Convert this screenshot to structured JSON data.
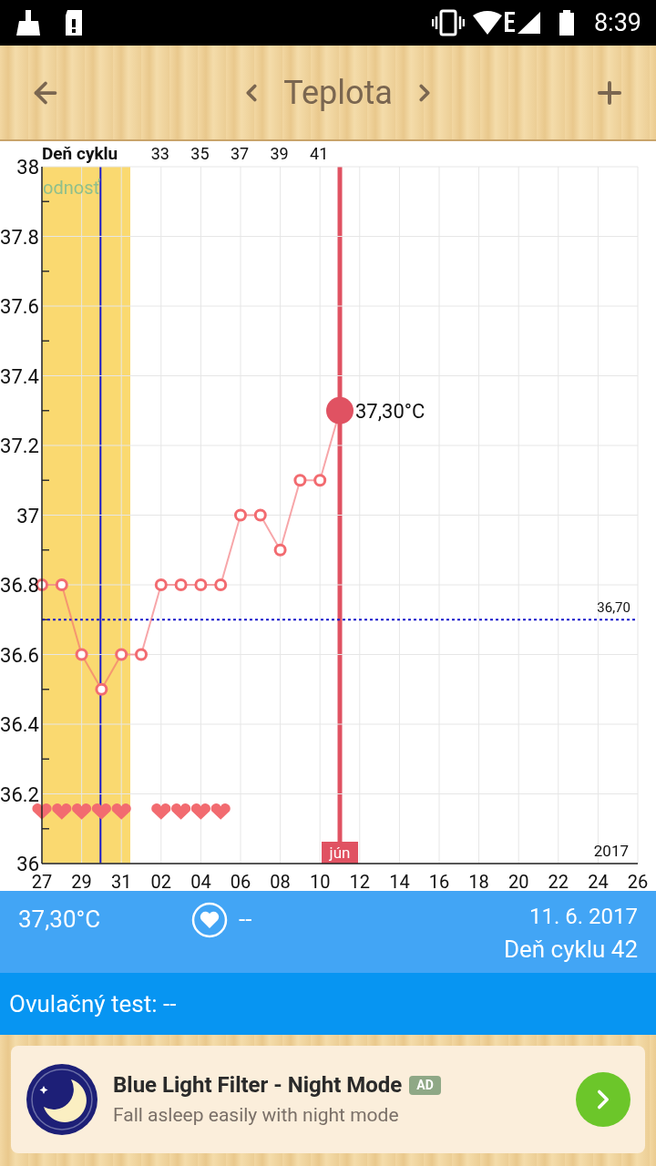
{
  "status_bar": {
    "time": "8:39"
  },
  "header": {
    "title": "Teplota"
  },
  "chart": {
    "chart_data": {
      "type": "line",
      "categories": [
        "27",
        null,
        "29",
        null,
        "31",
        null,
        "02",
        null,
        "04",
        null,
        "06",
        null,
        "08",
        null,
        "10",
        null,
        "12",
        null,
        "14",
        null,
        "16",
        null,
        "18",
        null,
        "20",
        null,
        "22",
        null,
        "24",
        null,
        "26"
      ],
      "grid": true,
      "series": [
        {
          "color": "#f26b70",
          "marker": "circle",
          "values": [
            36.8,
            36.8,
            36.6,
            36.5,
            36.6,
            36.6,
            36.8,
            36.8,
            36.8,
            36.8,
            37.0,
            37.0,
            36.9,
            37.1,
            37.1,
            37.3,
            null,
            null,
            null,
            null,
            null,
            null,
            null,
            null,
            null,
            null,
            null,
            null,
            null,
            null,
            null
          ]
        },
        {
          "color": "#f26b70",
          "type": "scatter",
          "values": [
            36.15,
            36.15,
            36.15,
            36.15,
            36.15,
            null,
            36.15,
            36.15,
            36.15,
            36.15,
            null,
            null,
            null,
            null,
            null,
            null,
            null,
            null,
            null,
            null,
            null,
            null,
            null,
            null,
            null,
            null,
            null,
            null,
            null,
            null,
            null
          ]
        }
      ],
      "ylim": [
        36,
        38
      ],
      "yticks": [
        {
          "value": 36,
          "label": "36"
        },
        {
          "value": 36.2,
          "label": "36.2"
        },
        {
          "value": 36.4,
          "label": "36.4"
        },
        {
          "value": 36.6,
          "label": "36.6"
        },
        {
          "value": 36.8,
          "label": "36.8"
        },
        {
          "value": 37,
          "label": "37"
        },
        {
          "value": 37.2,
          "label": "37.2"
        },
        {
          "value": 37.4,
          "label": "37.4"
        },
        {
          "value": 37.6,
          "label": "37.6"
        },
        {
          "value": 37.8,
          "label": "37.8"
        },
        {
          "value": 38,
          "label": "38"
        }
      ],
      "ref_lines": [
        {
          "axis": "y",
          "value": 36.7,
          "color": "#1a1acc",
          "label": "36,70"
        }
      ],
      "annotations": [
        "37,30°C",
        "2017"
      ]
    },
    "fertile_label": "odnosť",
    "month_label": "jún",
    "cycle_axis": {
      "title": "Deň cyklu",
      "labels": [
        "33",
        "35",
        "37",
        "39",
        "41"
      ]
    }
  },
  "info": {
    "temperature": "37,30°C",
    "intercourse": "--",
    "date": "11. 6. 2017",
    "cycle_day": "Deň cyklu 42"
  },
  "ovulation": {
    "text": "Ovulačný test: --"
  },
  "ad": {
    "title": "Blue Light Filter - Night Mode",
    "badge": "AD",
    "subtitle": "Fall asleep easily with night mode"
  }
}
